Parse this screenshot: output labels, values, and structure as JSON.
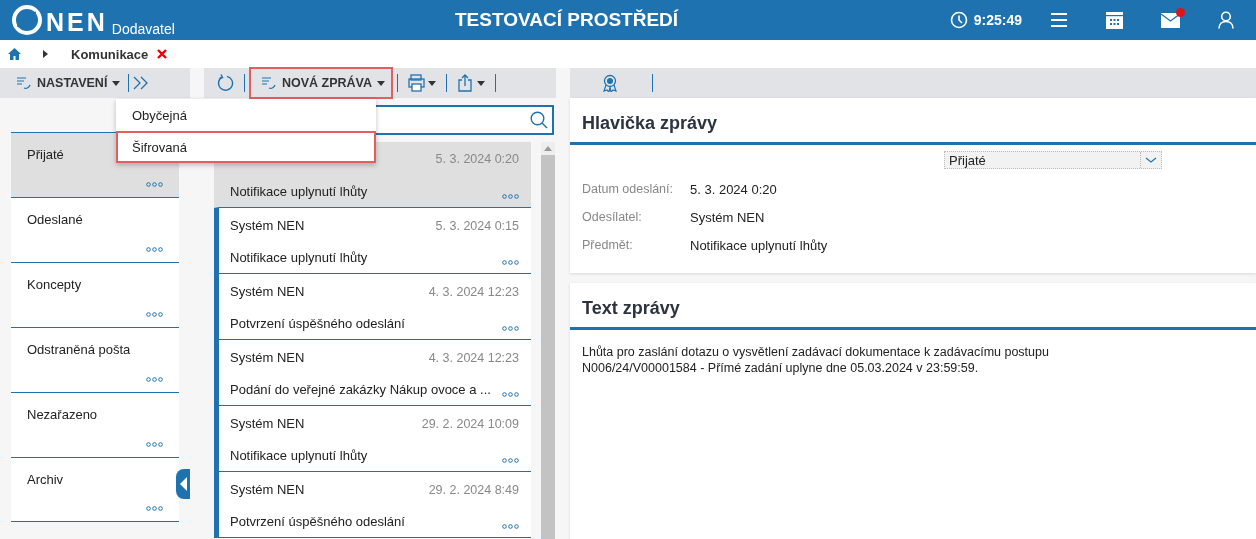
{
  "header": {
    "logo": "NEN",
    "logo_sub": "Dodavatel",
    "title": "TESTOVACÍ PROSTŘEDÍ",
    "time": "9:25:49",
    "mail_unread": true
  },
  "breadcrumb": {
    "items": [
      "Komunikace"
    ]
  },
  "folders_toolbar": {
    "settings": "NASTAVENÍ"
  },
  "folders": [
    {
      "label": "Přijaté",
      "selected": true
    },
    {
      "label": "Odeslané",
      "selected": false
    },
    {
      "label": "Koncepty",
      "selected": false
    },
    {
      "label": "Odstraněná pošta",
      "selected": false
    },
    {
      "label": "Nezařazeno",
      "selected": false
    },
    {
      "label": "Archiv",
      "selected": false
    }
  ],
  "messages_toolbar": {
    "new_message": "NOVÁ ZPRÁVA"
  },
  "new_message_menu": [
    {
      "label": "Obyčejná",
      "selected": false
    },
    {
      "label": "Šifrovaná",
      "selected": true
    }
  ],
  "messages": [
    {
      "date": "5. 3. 2024 0:20",
      "subject": "Notifikace uplynutí lhůty",
      "selected": true
    },
    {
      "sender": "Systém NEN",
      "date": "5. 3. 2024 0:15",
      "subject": "Notifikace uplynutí lhůty",
      "selected": false
    },
    {
      "sender": "Systém NEN",
      "date": "4. 3. 2024 12:23",
      "subject": "Potvrzení úspěšného odeslání",
      "selected": false
    },
    {
      "sender": "Systém NEN",
      "date": "4. 3. 2024 12:23",
      "subject": "Podání do veřejné zakázky Nákup ovoce a ...",
      "selected": false
    },
    {
      "sender": "Systém NEN",
      "date": "29. 2. 2024 10:09",
      "subject": "Notifikace uplynutí lhůty",
      "selected": false
    },
    {
      "sender": "Systém NEN",
      "date": "29. 2. 2024 8:49",
      "subject": "Potvrzení úspěšného odeslání",
      "selected": false
    }
  ],
  "detail": {
    "header_title": "Hlavička zprávy",
    "folder_select": "Přijaté",
    "fields": [
      {
        "label": "Datum odeslání:",
        "value": "5. 3. 2024 0:20"
      },
      {
        "label": "Odesílatel:",
        "value": "Systém NEN"
      },
      {
        "label": "Předmět:",
        "value": "Notifikace uplynutí lhůty"
      }
    ],
    "body_title": "Text zprávy",
    "body_text": "Lhůta pro zaslání dotazu o vysvětlení zadávací dokumentace k zadávacímu postupu N006/24/V00001584 - Přímé zadání uplyne dne 05.03.2024 v 23:59:59."
  }
}
